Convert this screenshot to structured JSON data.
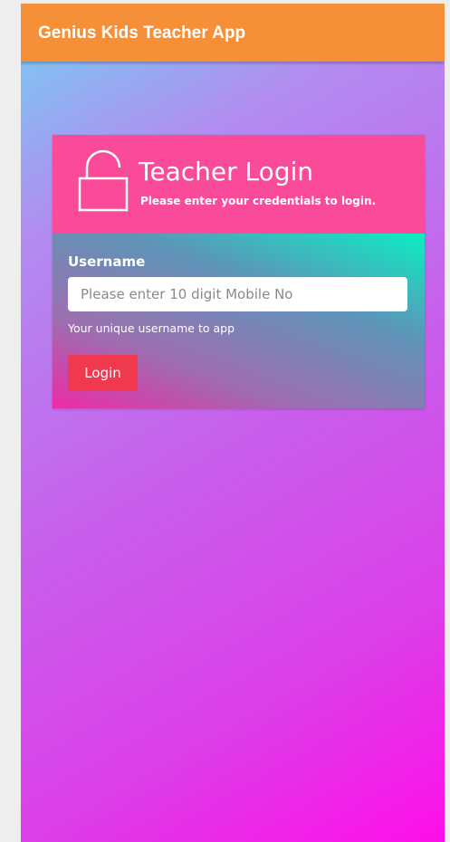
{
  "app_bar": {
    "title": "Genius Kids Teacher App",
    "background_color": "#f59038"
  },
  "login_card": {
    "icon": "unlock-icon",
    "title": "Teacher Login",
    "subtitle": "Please enter your credentials to login.",
    "header_color": "#fa4a9a",
    "username": {
      "label": "Username",
      "placeholder": "Please enter 10 digit Mobile No",
      "value": "",
      "help_text": "Your unique username to app"
    },
    "login_button": {
      "label": "Login",
      "color": "#f0394f"
    }
  }
}
